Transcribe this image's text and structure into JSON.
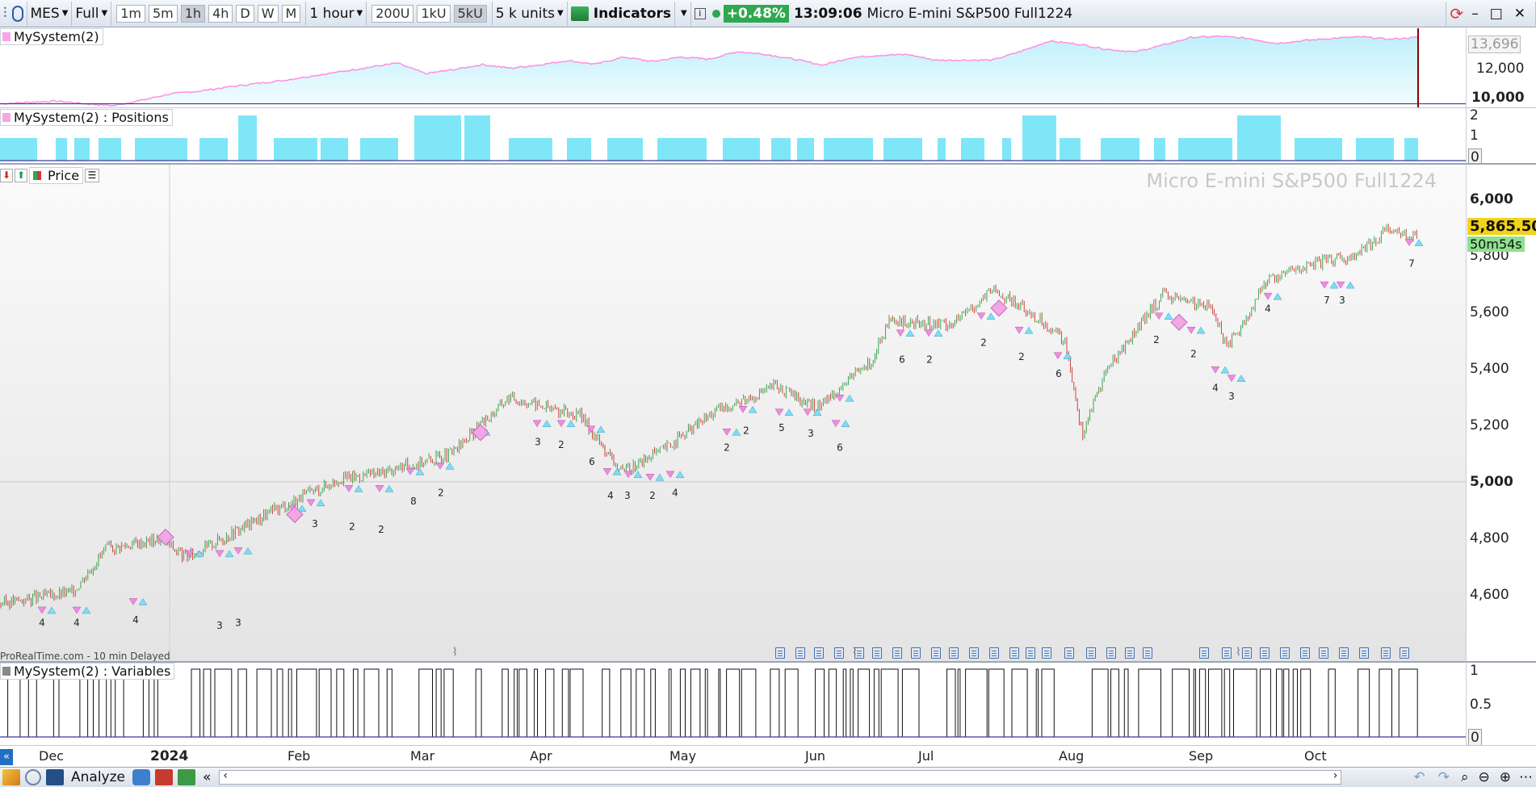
{
  "toolbar": {
    "symbol": "MES",
    "view_mode": "Full",
    "timeframes": [
      "1m",
      "5m",
      "1h",
      "4h",
      "D",
      "W",
      "M"
    ],
    "active_timeframe": "1h",
    "interval_label": "1 hour",
    "unit_buttons": [
      "200U",
      "1kU",
      "5kU"
    ],
    "active_unit": "5kU",
    "units_label": "5 k units",
    "indicators_label": "Indicators",
    "change_pct": "+0.48%",
    "time": "13:09:06",
    "instrument_name": "Micro E-mini S&P500 Full1224",
    "colors": {
      "accent": "#2fa84f",
      "equity_line": "#ff8fe0",
      "position_bar": "#7fe6f8"
    }
  },
  "equity_panel": {
    "title": "MySystem(2)",
    "last_value": "13,696",
    "ticks": [
      "12,000",
      "10,000"
    ],
    "baseline": 10000,
    "series": [
      10000,
      10080,
      10150,
      10000,
      9890,
      10200,
      10550,
      10700,
      10920,
      11120,
      11300,
      11550,
      11780,
      12030,
      12260,
      11680,
      11900,
      12180,
      11980,
      12160,
      12400,
      12200,
      12600,
      12350,
      12600,
      12480,
      12900,
      12750,
      12480,
      12150,
      12560,
      12700,
      12740,
      12420,
      12430,
      12430,
      12920,
      13490,
      13320,
      13040,
      12880,
      13260,
      13690,
      13750,
      13640,
      13360,
      13520,
      13640,
      13720,
      13590,
      13696
    ]
  },
  "positions_panel": {
    "title": "MySystem(2) : Positions",
    "ticks": [
      "2",
      "1",
      "0"
    ]
  },
  "price_panel": {
    "title": "Price",
    "watermark": "Micro E-mini S&P500 Full1224",
    "ticks": [
      "6,000",
      "5,800",
      "5,600",
      "5,400",
      "5,200",
      "5,000",
      "4,800",
      "4,600"
    ],
    "last_price": "5,865.50",
    "countdown": "50m54s",
    "data_source": "ProRealTime.com - 10 min Delayed",
    "trade_labels": [
      "4",
      "4",
      "4",
      "3",
      "3",
      "3",
      "2",
      "2",
      "8",
      "2",
      "3",
      "2",
      "6",
      "4",
      "3",
      "2",
      "4",
      "2",
      "2",
      "5",
      "3",
      "6",
      "6",
      "2",
      "2",
      "2",
      "6",
      "2",
      "2",
      "4",
      "3",
      "4",
      "7",
      "3",
      "7"
    ]
  },
  "variables_panel": {
    "title": "MySystem(2) : Variables",
    "ticks": [
      "1",
      "0.5",
      "0"
    ]
  },
  "x_axis": {
    "months": [
      "Dec",
      "2024",
      "Feb",
      "Mar",
      "Apr",
      "May",
      "Jun",
      "Jul",
      "Aug",
      "Sep",
      "Oct"
    ]
  },
  "statusbar": {
    "analyze_label": "Analyze"
  }
}
